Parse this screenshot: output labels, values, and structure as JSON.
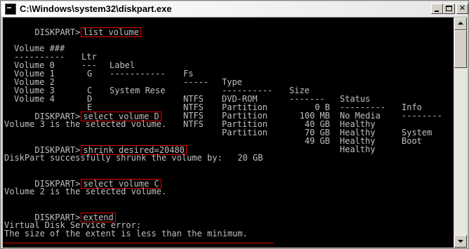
{
  "window": {
    "title": "C:\\Windows\\system32\\diskpart.exe",
    "icon": "console-icon"
  },
  "console": {
    "prompt": "DISKPART>",
    "commands": {
      "list_volume": "list volume",
      "select_d": "select volume D",
      "shrink": "shrink desired=20480",
      "select_c": "select volume C",
      "extend": "extend"
    },
    "table": {
      "headers": {
        "volume": "Volume ###",
        "ltr": "Ltr",
        "label": "Label",
        "fs": "Fs",
        "type": "Type",
        "size": "Size",
        "status": "Status",
        "info": "Info"
      },
      "separators": {
        "volume": "----------",
        "ltr": "---",
        "label": "-----------",
        "fs": "-----",
        "type": "----------",
        "size": "-------",
        "status": "---------",
        "info": "--------"
      },
      "rows": [
        {
          "volume": "Volume 0",
          "ltr": "G",
          "label": "",
          "fs": "",
          "type": "DVD-ROM",
          "size": "0 B",
          "status": "No Media",
          "info": ""
        },
        {
          "volume": "Volume 1",
          "ltr": "",
          "label": "System Rese",
          "fs": "NTFS",
          "type": "Partition",
          "size": "100 MB",
          "status": "Healthy",
          "info": "System"
        },
        {
          "volume": "Volume 2",
          "ltr": "C",
          "label": "",
          "fs": "NTFS",
          "type": "Partition",
          "size": "40 GB",
          "status": "Healthy",
          "info": "Boot"
        },
        {
          "volume": "Volume 3",
          "ltr": "D",
          "label": "",
          "fs": "NTFS",
          "type": "Partition",
          "size": "70 GB",
          "status": "Healthy",
          "info": ""
        },
        {
          "volume": "Volume 4",
          "ltr": "E",
          "label": "",
          "fs": "NTFS",
          "type": "Partition",
          "size": "49 GB",
          "status": "Healthy",
          "info": ""
        }
      ]
    },
    "outputs": {
      "selected_d": "Volume 3 is the selected volume.",
      "shrunk": "DiskPart successfully shrunk the volume by:   20 GB",
      "selected_c": "Volume 2 is the selected volume.",
      "error_title": "Virtual Disk Service error:",
      "error_message": "The size of the extent is less than the minimum."
    }
  },
  "colors": {
    "console_bg": "#000000",
    "console_text": "#c0c0c0",
    "highlight": "#e00000"
  }
}
